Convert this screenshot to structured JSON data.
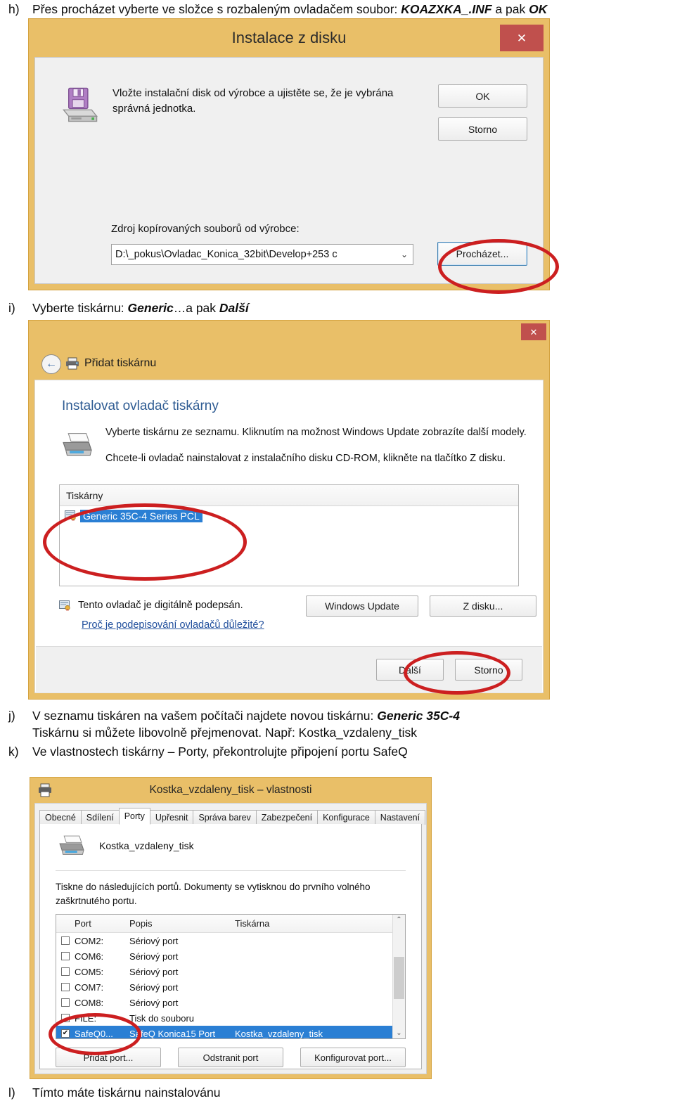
{
  "steps": {
    "h": {
      "marker": "h)",
      "text_parts": [
        {
          "t": "Přes procházet vyberte ve složce s rozbaleným ovladačem soubor: ",
          "style": "normal"
        },
        {
          "t": "KOAZXKA_.INF",
          "style": "bolditalic"
        },
        {
          "t": " a pak ",
          "style": "normal"
        },
        {
          "t": "OK",
          "style": "bolditalic"
        }
      ]
    },
    "i": {
      "marker": "i)",
      "text_parts": [
        {
          "t": "Vyberte tiskárnu: ",
          "style": "normal"
        },
        {
          "t": "Generic",
          "style": "bolditalic"
        },
        {
          "t": "…a pak ",
          "style": "normal"
        },
        {
          "t": "Další",
          "style": "bolditalic"
        }
      ]
    },
    "j": {
      "marker": "j)",
      "text_parts": [
        {
          "t": "V seznamu tiskáren na vašem počítači najdete novou tiskárnu: ",
          "style": "normal"
        },
        {
          "t": "Generic 35C-4",
          "style": "bolditalic"
        }
      ],
      "line2": "Tiskárnu si můžete libovolně přejmenovat. Např: Kostka_vzdaleny_tisk"
    },
    "k": {
      "marker": "k)",
      "text": "Ve vlastnostech tiskárny – Porty, překontrolujte připojení portu SafeQ"
    },
    "l": {
      "marker": "l)",
      "text": "Tímto máte tiskárnu nainstalovánu"
    }
  },
  "dialog_install_from_disk": {
    "title": "Instalace z disku",
    "close_label": "✕",
    "message": "Vložte instalační disk od výrobce a ujistěte se, že je vybrána správná jednotka.",
    "source_label": "Zdroj kopírovaných souborů od výrobce:",
    "source_value": "D:\\_pokus\\Ovladac_Konica_32bit\\Develop+253 c",
    "caret": "⌄",
    "buttons": {
      "ok": "OK",
      "storno": "Storno",
      "prochazet": "Procházet..."
    }
  },
  "dialog_add_printer": {
    "close_label": "✕",
    "back_label": "←",
    "header": "Přidat tiskárnu",
    "heading": "Instalovat ovladač tiskárny",
    "paragraph1": "Vyberte tiskárnu ze seznamu. Kliknutím na možnost Windows Update zobrazíte další modely.",
    "paragraph2": "Chcete-li ovladač nainstalovat z instalačního disku CD-ROM, klikněte na tlačítko Z disku.",
    "list_header": "Tiskárny",
    "list_items": [
      "Generic 35C-4 Series PCL"
    ],
    "signed_text": "Tento ovladač je digitálně podepsán.",
    "why_link": "Proč je podepisování ovladačů důležité?",
    "buttons": {
      "windows_update": "Windows Update",
      "z_disku": "Z disku...",
      "dalsi": "Další",
      "storno": "Storno"
    }
  },
  "dialog_printer_properties": {
    "title": "Kostka_vzdaleny_tisk – vlastnosti",
    "tabs": [
      {
        "label": "Obecné",
        "active": false
      },
      {
        "label": "Sdílení",
        "active": false
      },
      {
        "label": "Porty",
        "active": true
      },
      {
        "label": "Upřesnit",
        "active": false
      },
      {
        "label": "Správa barev",
        "active": false
      },
      {
        "label": "Zabezpečení",
        "active": false
      },
      {
        "label": "Konfigurace",
        "active": false
      },
      {
        "label": "Nastavení",
        "active": false
      }
    ],
    "printer_name": "Kostka_vzdaleny_tisk",
    "description": "Tiskne do následujících portů. Dokumenty se vytisknou do prvního volného zaškrtnutého portu.",
    "table": {
      "headers": [
        "Port",
        "Popis",
        "Tiskárna"
      ],
      "rows": [
        {
          "checked": false,
          "port": "COM2:",
          "popis": "Sériový port",
          "tiskarna": "",
          "selected": false
        },
        {
          "checked": false,
          "port": "COM6:",
          "popis": "Sériový port",
          "tiskarna": "",
          "selected": false
        },
        {
          "checked": false,
          "port": "COM5:",
          "popis": "Sériový port",
          "tiskarna": "",
          "selected": false
        },
        {
          "checked": false,
          "port": "COM7:",
          "popis": "Sériový port",
          "tiskarna": "",
          "selected": false
        },
        {
          "checked": false,
          "port": "COM8:",
          "popis": "Sériový port",
          "tiskarna": "",
          "selected": false
        },
        {
          "checked": false,
          "port": "FILE:",
          "popis": "Tisk do souboru",
          "tiskarna": "",
          "selected": false
        },
        {
          "checked": true,
          "port": "SafeQ0...",
          "popis": "SafeQ Konica15 Port",
          "tiskarna": "Kostka_vzdaleny_tisk",
          "selected": true
        }
      ]
    },
    "scroll_up": "⌃",
    "scroll_down": "⌄",
    "checkmark": "✔",
    "buttons": {
      "pridat_port": "Přidat port...",
      "odstranit_port": "Odstranit port",
      "konfigurovat_port": "Konfigurovat port..."
    }
  },
  "colors": {
    "title_bar": "#e9bf68",
    "close_red": "#c0504d",
    "annotation_red": "#cc1f20",
    "selection_blue": "#2a7fd4",
    "link_blue": "#1f4e9c",
    "heading_blue": "#2f5c93"
  }
}
